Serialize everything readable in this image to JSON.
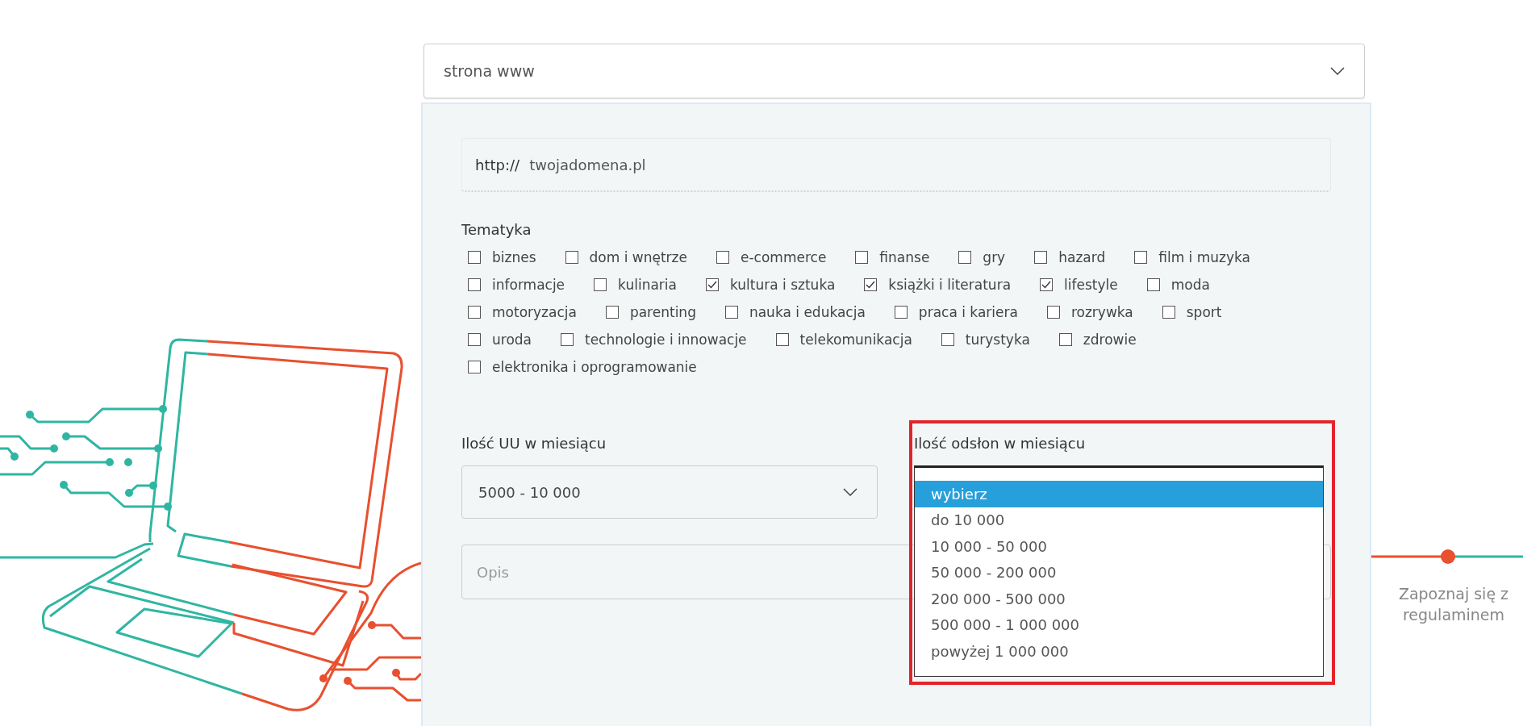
{
  "type_select": {
    "value": "strona www"
  },
  "url_field": {
    "prefix": "http://",
    "placeholder": "twojadomena.pl"
  },
  "topics": {
    "title": "Tematyka",
    "items": [
      {
        "label": "biznes",
        "checked": false
      },
      {
        "label": "dom i wnętrze",
        "checked": false
      },
      {
        "label": "e-commerce",
        "checked": false
      },
      {
        "label": "finanse",
        "checked": false
      },
      {
        "label": "gry",
        "checked": false
      },
      {
        "label": "hazard",
        "checked": false
      },
      {
        "label": "film i muzyka",
        "checked": false
      },
      {
        "label": "informacje",
        "checked": false
      },
      {
        "label": "kulinaria",
        "checked": false
      },
      {
        "label": "kultura i sztuka",
        "checked": true
      },
      {
        "label": "książki i literatura",
        "checked": true
      },
      {
        "label": "lifestyle",
        "checked": true
      },
      {
        "label": "moda",
        "checked": false
      },
      {
        "label": "motoryzacja",
        "checked": false
      },
      {
        "label": "parenting",
        "checked": false
      },
      {
        "label": "nauka i edukacja",
        "checked": false
      },
      {
        "label": "praca i kariera",
        "checked": false
      },
      {
        "label": "rozrywka",
        "checked": false
      },
      {
        "label": "sport",
        "checked": false
      },
      {
        "label": "uroda",
        "checked": false
      },
      {
        "label": "technologie i innowacje",
        "checked": false
      },
      {
        "label": "telekomunikacja",
        "checked": false
      },
      {
        "label": "turystyka",
        "checked": false
      },
      {
        "label": "zdrowie",
        "checked": false
      },
      {
        "label": "elektronika i oprogramowanie",
        "checked": false
      }
    ]
  },
  "uu_select": {
    "label": "Ilość UU w miesiącu",
    "value": "5000 - 10 000"
  },
  "views_select": {
    "label": "Ilość odsłon w miesiącu",
    "highlighted": true,
    "expanded": true,
    "options": [
      {
        "label": "wybierz",
        "selected": true
      },
      {
        "label": "do 10 000",
        "selected": false
      },
      {
        "label": "10 000 - 50 000",
        "selected": false
      },
      {
        "label": "50 000 - 200 000",
        "selected": false
      },
      {
        "label": "200 000 - 500 000",
        "selected": false
      },
      {
        "label": "500 000 - 1 000 000",
        "selected": false
      },
      {
        "label": "powyżej 1 000 000",
        "selected": false
      }
    ]
  },
  "description_field": {
    "placeholder": "Opis"
  },
  "side_step": {
    "label": "Zapoznaj się z regulaminem"
  }
}
